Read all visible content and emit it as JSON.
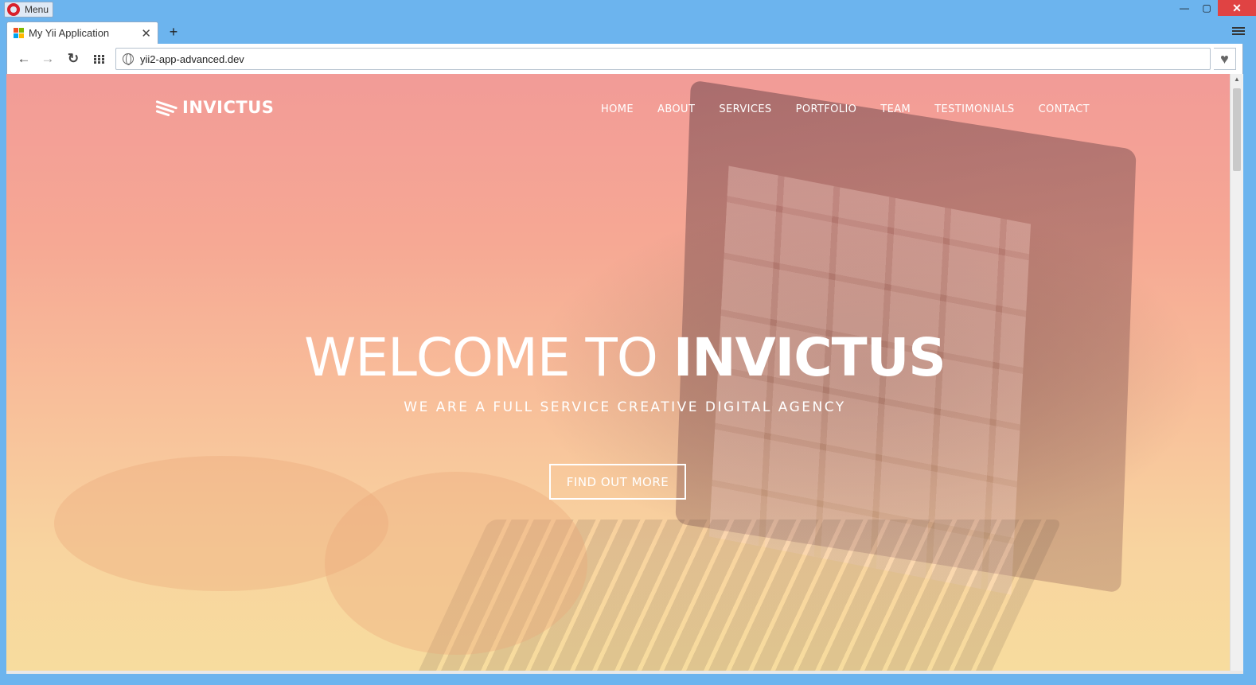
{
  "browser": {
    "menu_label": "Menu",
    "tab_title": "My Yii Application",
    "tab_close": "✕",
    "new_tab": "+",
    "back": "←",
    "forward": "→",
    "reload": "↻",
    "url": "yii2-app-advanced.dev",
    "minimize": "—",
    "maximize": "▢",
    "close": "✕",
    "heart": "♥"
  },
  "site": {
    "brand": "INVICTUS",
    "nav": [
      "HOME",
      "ABOUT",
      "SERVICES",
      "PORTFOLIO",
      "TEAM",
      "TESTIMONIALS",
      "CONTACT"
    ],
    "hero_title_light": "WELCOME TO ",
    "hero_title_bold": "INVICTUS",
    "hero_subtitle": "WE ARE A FULL SERVICE CREATIVE DIGITAL AGENCY",
    "cta_label": "FIND OUT MORE"
  },
  "colors": {
    "window_frame": "#6cb4ee",
    "close_button": "#e04343",
    "hero_gradient_top": "#f29b97",
    "hero_gradient_bottom": "#f7dc9e"
  }
}
